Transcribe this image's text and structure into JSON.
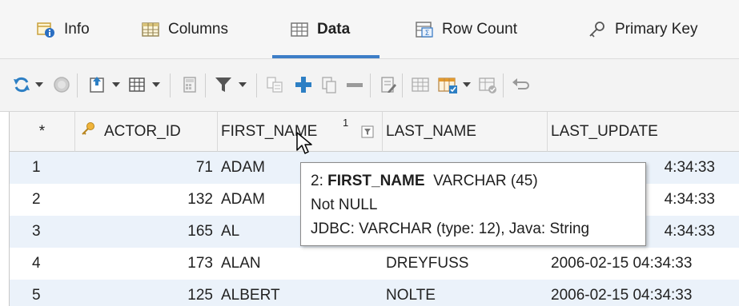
{
  "tabs": [
    {
      "label": "Info",
      "icon": "info-table-icon"
    },
    {
      "label": "Columns",
      "icon": "columns-table-icon"
    },
    {
      "label": "Data",
      "icon": "data-grid-icon",
      "active": true
    },
    {
      "label": "Row Count",
      "icon": "row-count-icon"
    },
    {
      "label": "Primary Key",
      "icon": "key-icon"
    }
  ],
  "toolbar": {
    "buttons": [
      "refresh-icon",
      "stop-icon",
      "export-icon",
      "grid-icon",
      "calculator-icon",
      "filter-icon",
      "copy-rows-icon",
      "add-row-icon",
      "duplicate-row-icon",
      "delete-row-icon",
      "edit-icon",
      "apply-icon",
      "apply-options-icon",
      "save-icon",
      "undo-icon"
    ]
  },
  "grid": {
    "header": {
      "row_marker": "*",
      "columns": [
        "ACTOR_ID",
        "FIRST_NAME",
        "LAST_NAME",
        "LAST_UPDATE"
      ],
      "sort_index": "1"
    },
    "rows": [
      {
        "n": "1",
        "actor_id": "71",
        "first_name": "ADAM",
        "last_name": "",
        "last_update": "4:34:33"
      },
      {
        "n": "2",
        "actor_id": "132",
        "first_name": "ADAM",
        "last_name": "",
        "last_update": "4:34:33"
      },
      {
        "n": "3",
        "actor_id": "165",
        "first_name": "AL",
        "last_name": "",
        "last_update": "4:34:33"
      },
      {
        "n": "4",
        "actor_id": "173",
        "first_name": "ALAN",
        "last_name": "DREYFUSS",
        "last_update": "2006-02-15 04:34:33"
      },
      {
        "n": "5",
        "actor_id": "125",
        "first_name": "ALBERT",
        "last_name": "NOLTE",
        "last_update": "2006-02-15 04:34:33"
      }
    ]
  },
  "tooltip": {
    "line1_prefix": "2: ",
    "line1_name": "FIRST_NAME",
    "line1_type": "  VARCHAR (45)",
    "line2": "Not NULL",
    "line3": "JDBC: VARCHAR (type: 12), Java: String"
  },
  "colors": {
    "accent": "#3d7ec7",
    "row_even": "#ebf2fa",
    "row_odd": "#ffffff",
    "header_bg": "#f5f5f5"
  }
}
